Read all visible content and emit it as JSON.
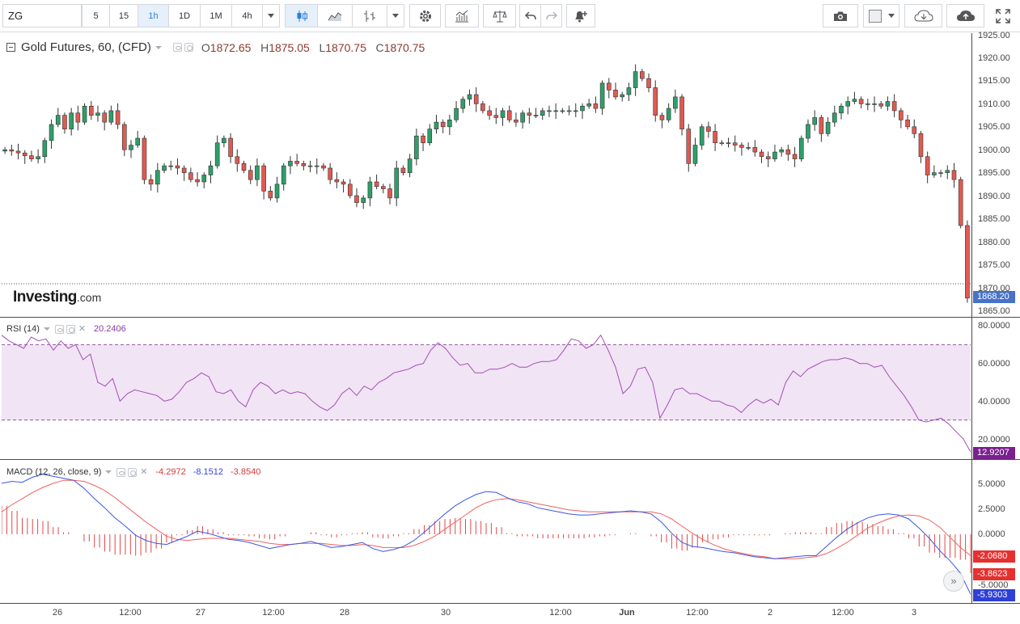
{
  "toolbar": {
    "symbol": "ZG",
    "intervals": [
      "5",
      "15",
      "1h",
      "1D",
      "1M",
      "4h"
    ],
    "active_interval": "1h"
  },
  "main": {
    "title": "Gold Futures, 60, (CFD)",
    "ohlc": {
      "o_label": "O",
      "o": "1872.65",
      "h_label": "H",
      "h": "1875.05",
      "l_label": "L",
      "l": "1870.75",
      "c_label": "C",
      "c": "1870.75"
    },
    "logo_main": "Investing",
    "logo_suffix": ".com",
    "last_price": "1868.20",
    "y_ticks": [
      "1925.00",
      "1920.00",
      "1915.00",
      "1910.00",
      "1905.00",
      "1900.00",
      "1895.00",
      "1890.00",
      "1885.00",
      "1880.00",
      "1875.00",
      "1870.00",
      "1865.00"
    ]
  },
  "rsi": {
    "title": "RSI (14)",
    "value": "20.2406",
    "last_value": "12.9207",
    "y_ticks": [
      "80.0000",
      "60.0000",
      "40.0000",
      "20.0000"
    ],
    "upper": 70,
    "lower": 30
  },
  "macd": {
    "title": "MACD (12, 26, close, 9)",
    "hist_value": "-4.2972",
    "macd_value": "-8.1512",
    "signal_value": "-3.8540",
    "badges": [
      "-2.0680",
      "-3.8623",
      "-5.9303"
    ],
    "y_ticks": [
      "5.0000",
      "2.5000",
      "0.0000",
      "-2.5000",
      "-5.0000"
    ]
  },
  "x_ticks": [
    "26",
    "12:00",
    "27",
    "12:00",
    "28",
    "30",
    "12:00",
    "Jun",
    "12:00",
    "2",
    "12:00",
    "3"
  ],
  "colors": {
    "up": "#26a69a",
    "up_fill": "#2e9f6a",
    "down": "#e05a52",
    "rsi": "#a34fb7",
    "rsi_band": "#f1e4f4",
    "macd_line": "#3c57e0",
    "signal_line": "#f06060",
    "hist": "#e04848",
    "last_price": "#4872c8",
    "rsi_badge": "#7a1f8e"
  },
  "chart_data": [
    {
      "type": "candlestick",
      "title": "Gold Futures, 60, (CFD)",
      "ylim": [
        1865,
        1925
      ],
      "ohlc_last": {
        "open": 1872.65,
        "high": 1875.05,
        "low": 1870.75,
        "close": 1870.75
      },
      "close": [
        1900.5,
        1900.2,
        1899.8,
        1899.2,
        1898.5,
        1899.0,
        1902.5,
        1906.0,
        1908.0,
        1905.0,
        1908.5,
        1906.5,
        1910.0,
        1908.0,
        1908.5,
        1906.5,
        1909.0,
        1906.0,
        1900.5,
        1901.5,
        1903.0,
        1894.0,
        1893.0,
        1896.0,
        1897.0,
        1897.0,
        1896.5,
        1895.5,
        1894.0,
        1893.5,
        1895.0,
        1897.0,
        1902.0,
        1903.0,
        1899.0,
        1897.5,
        1896.0,
        1894.0,
        1897.0,
        1891.5,
        1890.0,
        1893.0,
        1897.0,
        1898.0,
        1897.5,
        1897.0,
        1897.0,
        1897.0,
        1896.5,
        1894.0,
        1893.5,
        1893.0,
        1890.5,
        1889.0,
        1890.0,
        1893.5,
        1892.5,
        1892.0,
        1890.0,
        1896.5,
        1895.5,
        1898.5,
        1903.5,
        1902.0,
        1905.0,
        1906.5,
        1905.5,
        1907.0,
        1909.5,
        1911.5,
        1912.5,
        1910.5,
        1909.0,
        1908.0,
        1907.5,
        1909.0,
        1907.0,
        1906.5,
        1908.5,
        1908.0,
        1908.0,
        1909.0,
        1909.0,
        1909.0,
        1909.0,
        1909.0,
        1909.0,
        1910.0,
        1910.5,
        1909.5,
        1915.0,
        1913.5,
        1912.0,
        1912.5,
        1914.0,
        1917.5,
        1916.0,
        1914.0,
        1908.0,
        1907.0,
        1909.5,
        1912.0,
        1905.0,
        1897.5,
        1901.5,
        1905.5,
        1904.5,
        1902.0,
        1902.0,
        1902.0,
        1901.5,
        1901.0,
        1901.0,
        1900.0,
        1899.0,
        1898.5,
        1900.0,
        1900.5,
        1899.5,
        1898.5,
        1903.0,
        1906.0,
        1907.5,
        1904.0,
        1906.5,
        1908.5,
        1910.0,
        1911.0,
        1911.5,
        1910.5,
        1910.5,
        1910.5,
        1910.0,
        1911.0,
        1909.0,
        1907.0,
        1905.5,
        1904.0,
        1899.0,
        1895.0,
        1895.5,
        1895.5,
        1896.0,
        1894.0,
        1884.0,
        1868.2
      ]
    },
    {
      "type": "line",
      "title": "RSI (14)",
      "ylim": [
        12,
        82
      ],
      "bands": [
        30,
        70
      ],
      "values": [
        75,
        72,
        70,
        68,
        74,
        72,
        73,
        67,
        72,
        68,
        70,
        62,
        65,
        50,
        48,
        52,
        40,
        44,
        46,
        45,
        44,
        43,
        40,
        41,
        45,
        50,
        52,
        55,
        53,
        45,
        44,
        46,
        40,
        37,
        46,
        50,
        48,
        44,
        46,
        44,
        45,
        44,
        40,
        37,
        35,
        38,
        44,
        47,
        43,
        48,
        46,
        50,
        52,
        55,
        56,
        57,
        59,
        60,
        67,
        71,
        68,
        63,
        59,
        60,
        55,
        55,
        57,
        57,
        58,
        60,
        58,
        58,
        60,
        61,
        61,
        62,
        67,
        73,
        72,
        68,
        70,
        75,
        67,
        58,
        44,
        48,
        57,
        58,
        50,
        31,
        38,
        46,
        47,
        44,
        44,
        42,
        40,
        40,
        38,
        37,
        34,
        38,
        41,
        39,
        41,
        38,
        50,
        56,
        53,
        57,
        59,
        61,
        62,
        62,
        63,
        62,
        60,
        60,
        58,
        59,
        53,
        48,
        43,
        37,
        30,
        29,
        30,
        31,
        28,
        24,
        20,
        13
      ]
    },
    {
      "type": "line",
      "title": "MACD (12, 26, close, 9)",
      "ylim": [
        -6.5,
        6.5
      ],
      "series": [
        {
          "name": "MACD",
          "values": [
            5.0,
            5.2,
            5.1,
            5.6,
            5.9,
            5.7,
            5.5,
            5.3,
            4.5,
            3.5,
            2.6,
            1.6,
            0.8,
            -0.1,
            -0.6,
            -0.9,
            -1.0,
            -0.6,
            -0.2,
            0.3,
            0.1,
            -0.2,
            -0.5,
            -0.6,
            -0.8,
            -1.1,
            -1.4,
            -1.2,
            -1.0,
            -0.9,
            -0.7,
            -1.0,
            -1.3,
            -1.2,
            -1.0,
            -0.8,
            -1.4,
            -1.7,
            -1.5,
            -1.2,
            -0.6,
            0.2,
            1.1,
            2.0,
            2.8,
            3.4,
            3.9,
            4.2,
            4.1,
            3.6,
            3.2,
            3.0,
            2.6,
            2.4,
            2.2,
            2.0,
            1.9,
            1.9,
            2.0,
            2.1,
            2.2,
            2.3,
            2.2,
            2.0,
            1.2,
            0.1,
            -0.8,
            -1.2,
            -1.3,
            -1.5,
            -1.7,
            -1.8,
            -2.0,
            -2.2,
            -2.3,
            -2.4,
            -2.3,
            -2.2,
            -2.1,
            -2.1,
            -1.2,
            -0.3,
            0.5,
            1.1,
            1.6,
            1.9,
            2.0,
            1.9,
            1.5,
            0.6,
            -0.4,
            -1.6,
            -2.6,
            -3.8,
            -5.9
          ]
        },
        {
          "name": "Signal",
          "values": [
            2.2,
            2.9,
            3.5,
            4.1,
            4.6,
            5.0,
            5.3,
            5.3,
            5.2,
            4.8,
            4.3,
            3.6,
            2.8,
            2.0,
            1.2,
            0.5,
            -0.2,
            -0.5,
            -0.6,
            -0.5,
            -0.4,
            -0.4,
            -0.4,
            -0.5,
            -0.6,
            -0.7,
            -0.9,
            -1.0,
            -1.0,
            -0.9,
            -0.9,
            -0.9,
            -1.0,
            -1.1,
            -1.1,
            -1.0,
            -1.1,
            -1.3,
            -1.3,
            -1.3,
            -1.1,
            -0.7,
            -0.2,
            0.5,
            1.2,
            1.9,
            2.6,
            3.1,
            3.4,
            3.5,
            3.4,
            3.2,
            3.0,
            2.8,
            2.6,
            2.4,
            2.3,
            2.2,
            2.2,
            2.2,
            2.2,
            2.2,
            2.2,
            2.2,
            2.0,
            1.5,
            0.8,
            0.1,
            -0.5,
            -1.0,
            -1.4,
            -1.7,
            -1.9,
            -2.1,
            -2.2,
            -2.4,
            -2.4,
            -2.4,
            -2.3,
            -2.2,
            -1.9,
            -1.4,
            -0.8,
            -0.1,
            0.6,
            1.1,
            1.5,
            1.8,
            1.9,
            1.8,
            1.4,
            0.7,
            -0.3,
            -1.3,
            -2.1
          ]
        },
        {
          "name": "Histogram",
          "values": [
            2.8,
            2.3,
            1.6,
            1.5,
            1.3,
            0.7,
            0.2,
            0.0,
            -0.7,
            -1.3,
            -1.7,
            -2.0,
            -2.0,
            -2.1,
            -1.8,
            -1.4,
            -0.8,
            -0.1,
            0.4,
            0.8,
            0.5,
            0.2,
            -0.1,
            -0.1,
            -0.2,
            -0.4,
            -0.5,
            -0.2,
            0.0,
            0.0,
            0.2,
            -0.1,
            -0.3,
            -0.1,
            0.1,
            0.2,
            -0.3,
            -0.4,
            -0.2,
            0.1,
            0.5,
            0.9,
            1.3,
            1.5,
            1.6,
            1.5,
            1.3,
            1.1,
            0.7,
            0.1,
            -0.2,
            -0.2,
            -0.4,
            -0.4,
            -0.4,
            -0.4,
            -0.4,
            -0.3,
            -0.2,
            -0.1,
            0.0,
            0.1,
            0.0,
            -0.2,
            -0.8,
            -1.4,
            -1.6,
            -1.3,
            -0.8,
            -0.5,
            -0.3,
            -0.1,
            -0.1,
            -0.1,
            -0.1,
            0.0,
            0.1,
            0.2,
            0.2,
            0.1,
            0.7,
            1.1,
            1.3,
            1.2,
            1.0,
            0.8,
            0.5,
            0.1,
            -0.4,
            -1.2,
            -1.8,
            -2.3,
            -2.3,
            -2.5,
            -3.8
          ]
        }
      ]
    }
  ]
}
